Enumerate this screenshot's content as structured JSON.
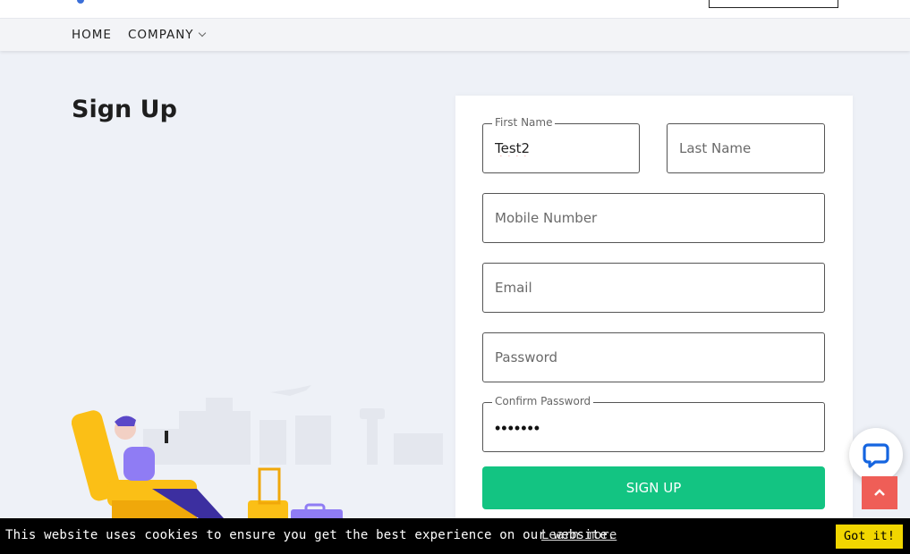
{
  "nav": {
    "home": "HOME",
    "company": "COMPANY"
  },
  "page": {
    "title": "Sign Up"
  },
  "form": {
    "first_name_label": "First Name",
    "first_name_value": "Test2",
    "last_name_placeholder": "Last Name",
    "mobile_placeholder": "Mobile Number",
    "email_placeholder": "Email",
    "password_placeholder": "Password",
    "confirm_password_label": "Confirm Password",
    "confirm_password_masked": "•••••••",
    "submit_label": "SIGN UP"
  },
  "cookie": {
    "message": "This website uses cookies to ensure you get the best experience on our website.",
    "link": "Learn more",
    "accept": "Got it!"
  },
  "colors": {
    "accent_green": "#13c482",
    "scroll_top_red": "#ef5e57",
    "cookie_button_yellow": "#f1d600",
    "chat_blue": "#1565e0"
  },
  "icons": {
    "chat": "chat-bubble-icon",
    "scroll_top": "chevron-up-icon",
    "dropdown": "chevron-down-icon"
  }
}
